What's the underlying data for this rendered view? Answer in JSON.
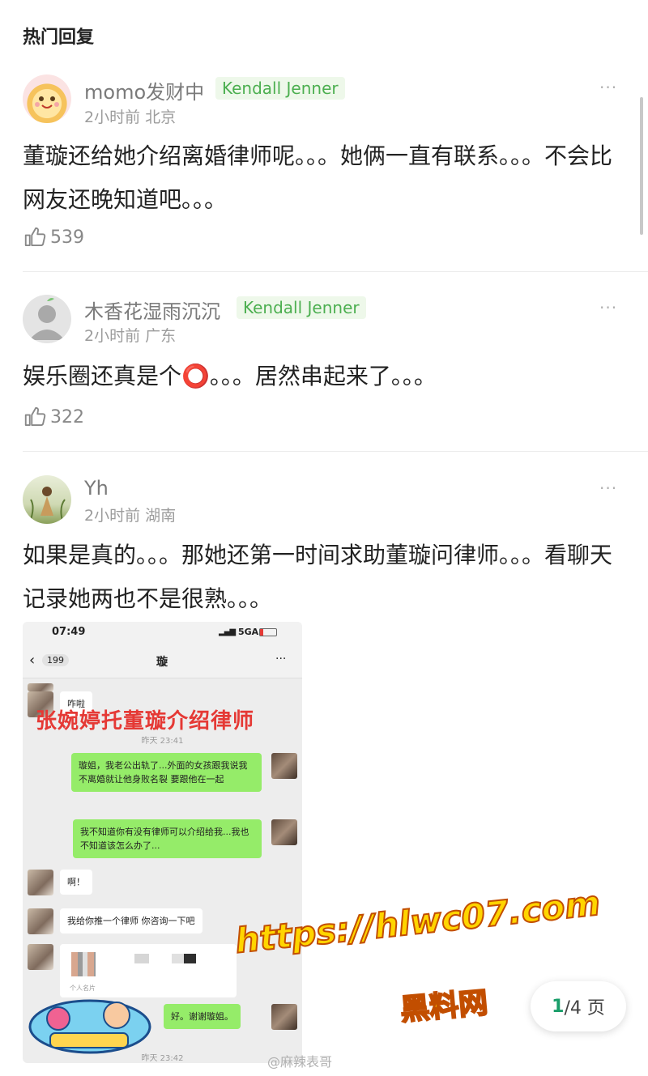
{
  "section_title": "热门回复",
  "comments": [
    {
      "username": "momo发财中",
      "badge": "Kendall Jenner",
      "meta": "2小时前 北京",
      "text": "董璇还给她介绍离婚律师呢。。。她俩一直有联系。。。不会比网友还晚知道吧。。。",
      "likes": "539"
    },
    {
      "username": "木香花湿雨沉沉",
      "badge": "Kendall Jenner",
      "meta": "2小时前 广东",
      "text": "娱乐圈还真是个⭕。。。居然串起来了。。。",
      "likes": "322"
    },
    {
      "username": "Yh",
      "badge": "",
      "meta": "2小时前 湖南",
      "text": "如果是真的。。。那她还第一时间求助董璇问律师。。。看聊天记录她两也不是很熟。。。",
      "likes": ""
    }
  ],
  "more_icon": "···",
  "chat": {
    "status_time": "07:49",
    "status_right": "5GA",
    "back_count": "199",
    "title": "璇",
    "more": "···",
    "caption": "张婉婷托董璇介绍律师",
    "time1": "昨天 23:41",
    "time2": "昨天 23:42",
    "messages": {
      "m1": "咋啦",
      "m2": "璇姐，我老公出轨了...外面的女孩跟我说我不离婚就让他身败名裂 要跟他在一起",
      "m3": "我不知道你有没有律师可以介绍给我...我也不知道该怎么办了...",
      "m4": "啊！",
      "m5": "我给你推一个律师 你咨询一下吧",
      "m6_label": "个人名片",
      "m7": "好。谢谢璇姐。"
    }
  },
  "pager": {
    "current": "1",
    "total": "/4 页"
  },
  "watermark": {
    "url": "https://hlwc07.com",
    "site": "黑料网",
    "weibo": "@麻辣表哥"
  },
  "colors": {
    "badge_green": "#4caf50",
    "pager_green": "#1a9e6a",
    "chat_green": "#95ec69"
  }
}
